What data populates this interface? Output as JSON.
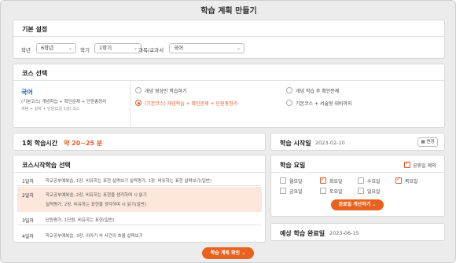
{
  "window": {
    "title": "학습 계획 만들기"
  },
  "basic": {
    "heading": "기본 설정",
    "grade_label": "학년",
    "grade_value": "6학년",
    "term_label": "학기",
    "term_value": "1학기",
    "subject_label": "과목/교과서",
    "subject_value": "국어"
  },
  "course": {
    "heading": "코스 선택",
    "subject": "국어",
    "selected_desc1": "(기본코스) 개념학습 + 확인문제 + 단원총정리",
    "selected_desc2": "개념 + 실력 + 단원(1일 1강) 코스",
    "options": [
      {
        "label": "개념 영상만 학습하기",
        "selected": false
      },
      {
        "label": "개념 학습 후 확인문제",
        "selected": false
      },
      {
        "label": "(기본코스) 개념학습 + 확인문제 + 단원총정리",
        "selected": true
      },
      {
        "label": "기본코스 + 서술형 대비까지",
        "selected": false
      }
    ]
  },
  "session": {
    "label": "1회 학습시간",
    "value": "약 20~25 분"
  },
  "start_date": {
    "label": "학습 시작일",
    "value": "2023-02-10",
    "change_label": "변경"
  },
  "start_lesson": {
    "heading": "코스시작학습 선택",
    "rows": [
      {
        "day": "1일차",
        "lines": [
          "학교공부예복습, 1장. 비유하는 표현 살펴보기   실력평가, 1장. 비유하는 표현 살펴보기(일반)"
        ]
      },
      {
        "day": "2일차",
        "lines": [
          "학교공부예복습, 2장. 비유하는 표현을 생각하며 시 읽기",
          "실력평가, 2장. 비유하는 표현을 생각하며 시 읽기(일반)"
        ]
      },
      {
        "day": "3일차",
        "lines": [
          "단원평가, 1단원. 비유하는 표현(일반)"
        ]
      },
      {
        "day": "4일차",
        "lines": [
          "학교공부예복습, 3장. 이야기 속 사건의 흐름 살펴보기"
        ]
      }
    ]
  },
  "days": {
    "heading": "학습 요일",
    "holiday_label": "공휴일 제외",
    "holiday_checked": true,
    "list": [
      {
        "label": "월요일",
        "checked": false
      },
      {
        "label": "화요일",
        "checked": true
      },
      {
        "label": "수요일",
        "checked": false
      },
      {
        "label": "목요일",
        "checked": true
      },
      {
        "label": "금요일",
        "checked": false
      },
      {
        "label": "토요일",
        "checked": false
      },
      {
        "label": "일요일",
        "checked": false
      }
    ],
    "calc_button": "완료일 계산하기"
  },
  "end_date": {
    "label": "예상 학습 완료일",
    "value": "2023-06-15"
  },
  "confirm_button": "학습 계획 확인",
  "colors": {
    "accent": "#e8621f",
    "highlight": "#fde7dc"
  }
}
